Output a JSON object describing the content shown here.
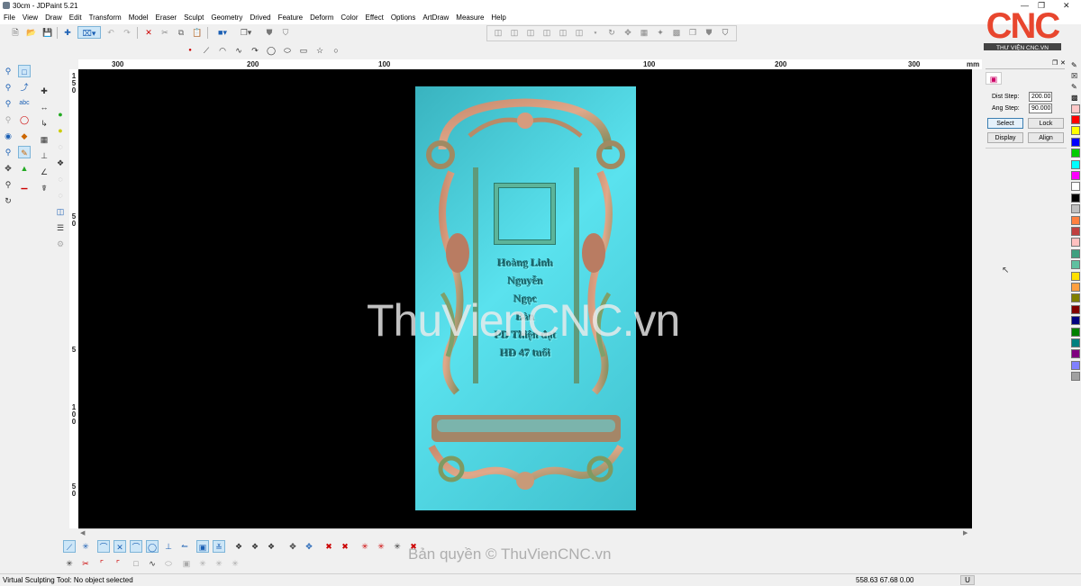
{
  "window": {
    "title": "30cm - JDPaint 5.21"
  },
  "menu": [
    "File",
    "View",
    "Draw",
    "Edit",
    "Transform",
    "Model",
    "Eraser",
    "Sculpt",
    "Geometry",
    "Drived",
    "Feature",
    "Deform",
    "Color",
    "Effect",
    "Options",
    "ArtDraw",
    "Measure",
    "Help"
  ],
  "ruler": {
    "top_labels": [
      "300",
      "200",
      "100",
      "100",
      "200",
      "300"
    ],
    "unit": "mm",
    "left_labels": [
      "1",
      "5",
      "0",
      "5",
      "0",
      "5",
      "1",
      "0",
      "0",
      "5",
      "0"
    ]
  },
  "plaque": {
    "lines": [
      "Hoàng Linh",
      "Nguyễn",
      "Ngọc",
      "Bàn",
      "PD Thiện đạt",
      "HĐ 47 tuổi"
    ]
  },
  "watermark": "ThuVienCNC.vn",
  "copyright": "Bản quyền © ThuVienCNC.vn",
  "panel": {
    "dist_step_label": "Dist Step:",
    "dist_step_value": "200.000",
    "ang_step_label": "Ang Step:",
    "ang_step_value": "90.000",
    "buttons": {
      "select": "Select",
      "lock": "Lock",
      "display": "Display",
      "align": "Align"
    }
  },
  "palette": [
    "#ff0000",
    "#ffff00",
    "#0000ff",
    "#00cc00",
    "#00ffff",
    "#ff00ff",
    "#ffffff",
    "#000000",
    "#c0c0c0",
    "#ff8040",
    "#c04040",
    "#ffc0c0",
    "#40a080",
    "#60c0a0",
    "#ffe000",
    "#ffa040",
    "#808000",
    "#800000",
    "#000080",
    "#008000",
    "#008080",
    "#800080",
    "#8080ff",
    "#a0a0a0"
  ],
  "status": {
    "message": "Virtual Sculpting Tool: No object selected",
    "coords": "558.63 67.68 0.00",
    "indicator": "U"
  },
  "logo": {
    "text": "CNC",
    "subtitle": "THƯ VIỆN CNC.VN"
  }
}
